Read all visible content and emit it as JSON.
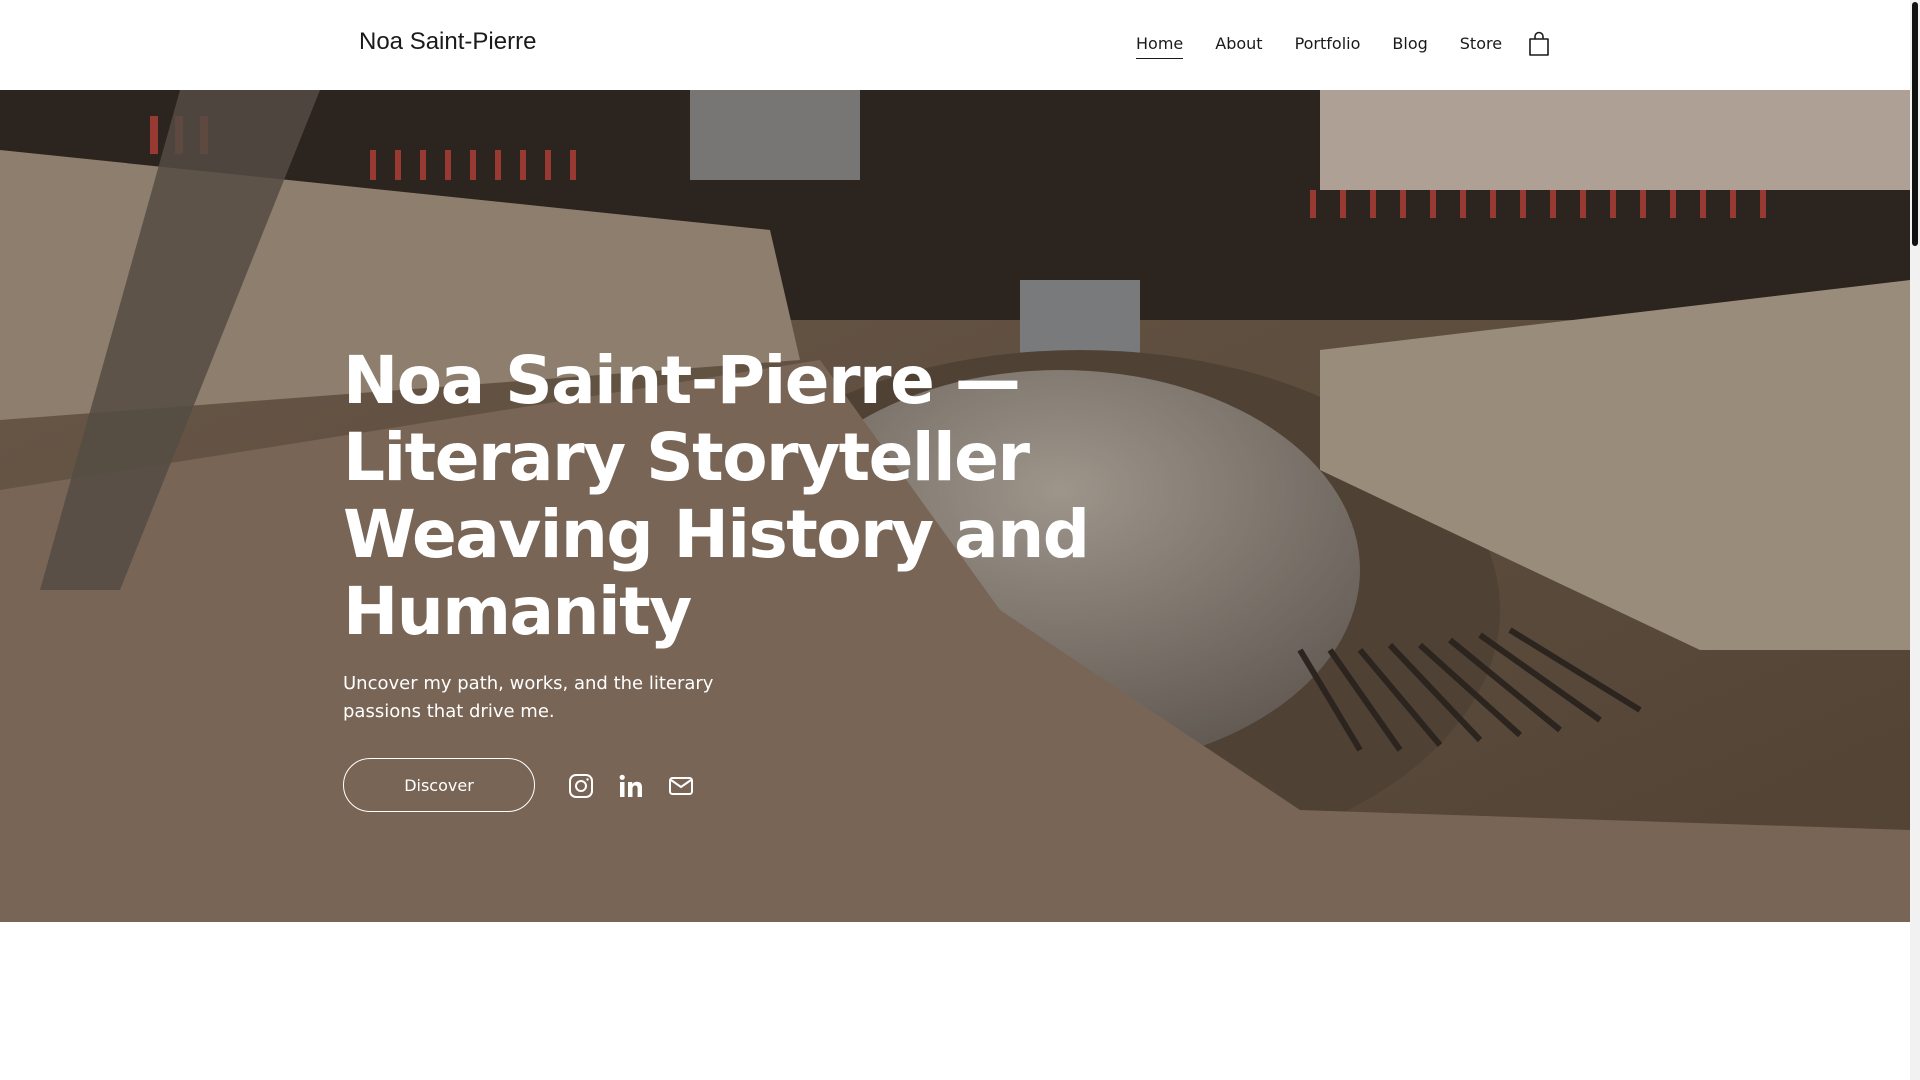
{
  "site": {
    "title": "Noa Saint-Pierre"
  },
  "nav": {
    "items": [
      {
        "label": "Home",
        "active": true
      },
      {
        "label": "About"
      },
      {
        "label": "Portfolio"
      },
      {
        "label": "Blog"
      },
      {
        "label": "Store"
      }
    ],
    "cart_icon": "shopping-bag-icon"
  },
  "hero": {
    "title": "Noa Saint-Pierre — Literary Storyteller Weaving History and Humanity",
    "subtitle": "Uncover my path, works, and the literary passions that drive me.",
    "cta_label": "Discover",
    "background_image": "typewriter close-up photo",
    "social_icons": [
      "instagram-icon",
      "linkedin-icon",
      "email-icon"
    ]
  },
  "colors": {
    "header_bg": "#ffffff",
    "text_dark": "#1a1a1a",
    "hero_text": "#ffffff",
    "hero_tone": "#6b5a4a"
  }
}
